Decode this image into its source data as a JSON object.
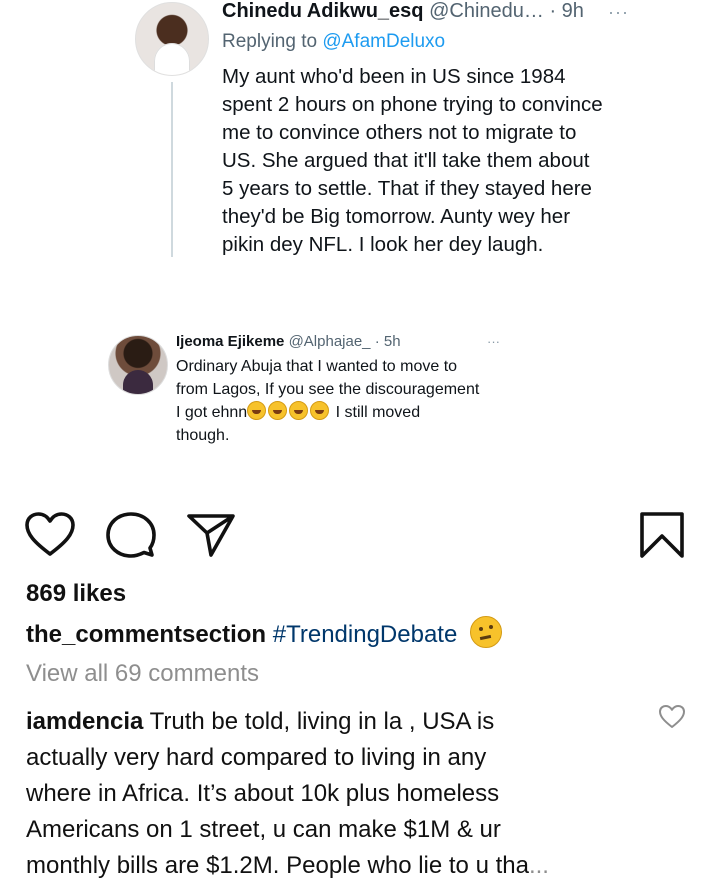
{
  "tweet_reply": {
    "name": "Chinedu Adikwu_esq",
    "handle": "@Chinedu…",
    "time": "· 9h",
    "more": "···",
    "replying_prefix": "Replying to ",
    "replying_user": "@AfamDeluxo",
    "lines": [
      "My aunt who'd been in US since 1984",
      "spent 2 hours on phone trying to convince",
      "me to convince others not to migrate to",
      "US. She argued that it'll take them about",
      "5 years to settle. That if they stayed here",
      "they'd be Big tomorrow. Aunty wey her",
      "pikin dey NFL. I look her dey laugh."
    ]
  },
  "tweet_second": {
    "name": "Ijeoma Ejikeme",
    "handle": "@Alphajae_",
    "time": "· 5h",
    "more": "···",
    "line1": "Ordinary Abuja that I wanted to move to",
    "line2": "from Lagos, If you see the discouragement",
    "line3_pre": "I got ehnn",
    "line3_post": " I still moved",
    "line4": "though.",
    "emoji_icon": "rofl-emoji-icon"
  },
  "post": {
    "likes": "869 likes",
    "caption_user": "the_commentsection",
    "caption_tag": "#TrendingDebate",
    "caption_emoji": "thinking-face-emoji",
    "view_all": "View all 69 comments",
    "comment_user": "iamdencia",
    "comment_lines": [
      " Truth be told, living in la , USA is",
      "actually very hard compared to living in any",
      "where in Africa. It’s about 10k plus homeless",
      "Americans on 1 street, u can make $1M & ur",
      "monthly bills are $1.2M. People who lie to u tha"
    ],
    "comment_more": "..."
  },
  "icons": [
    "heart-icon",
    "comment-icon",
    "share-icon",
    "bookmark-icon",
    "small-heart-icon"
  ],
  "colors": {
    "link_blue": "#1d9bf0",
    "hashtag": "#00376b",
    "muted": "#8e8e8e"
  }
}
